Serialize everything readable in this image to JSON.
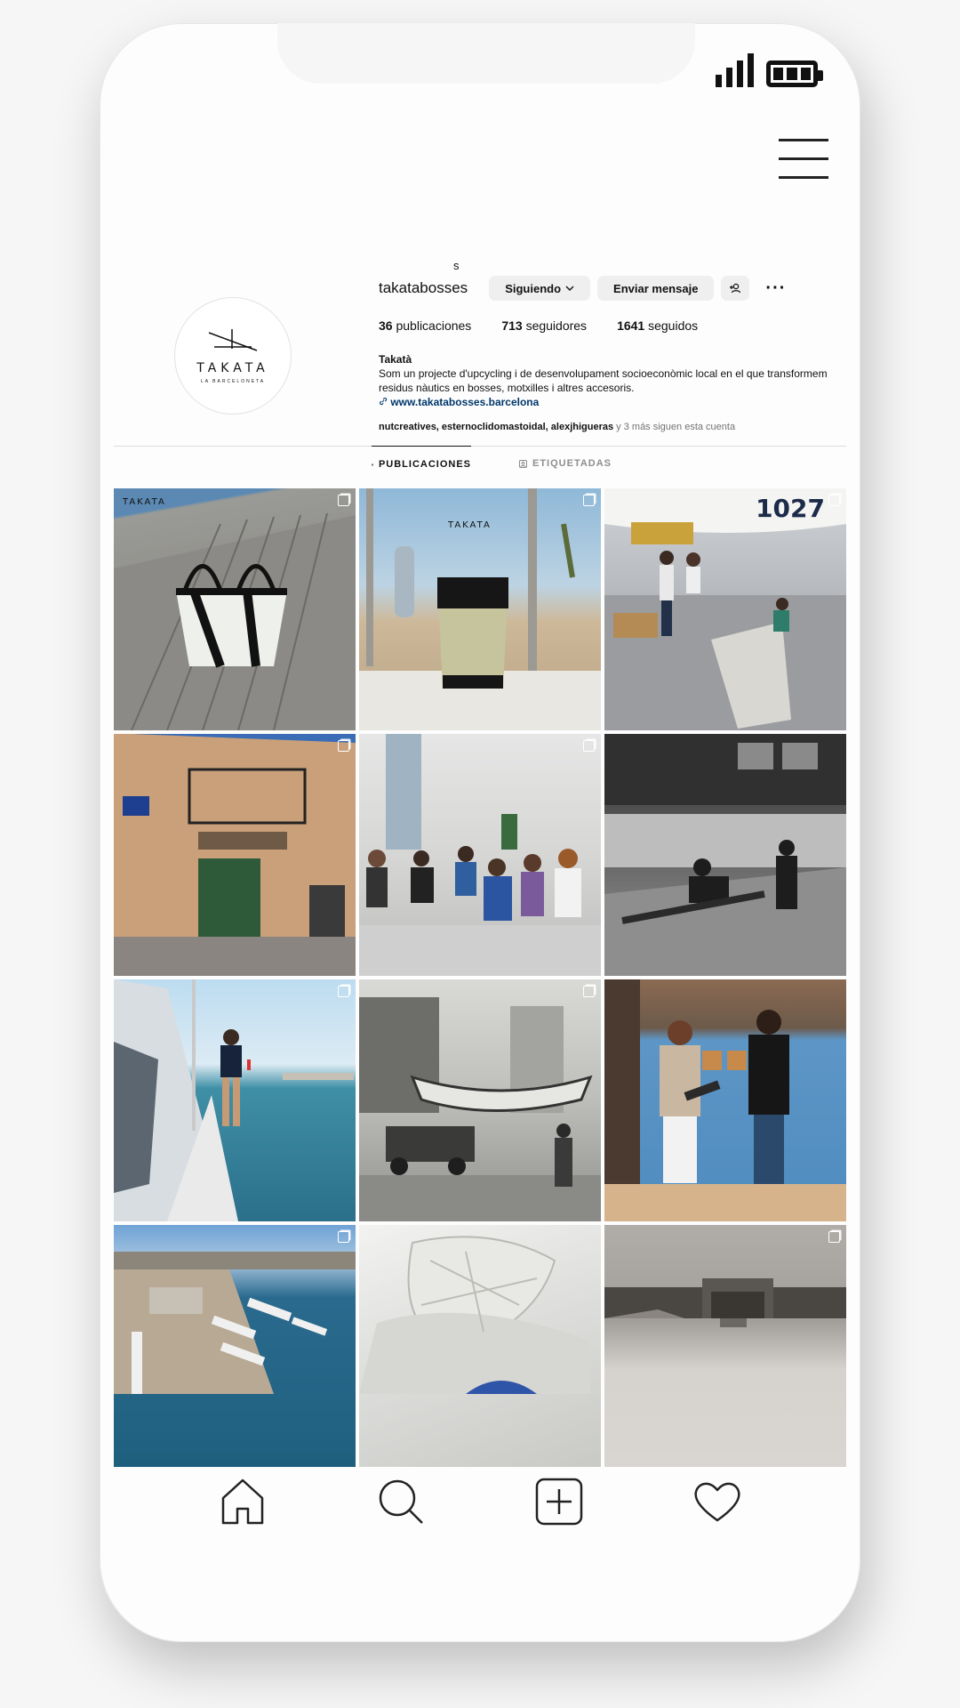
{
  "profile": {
    "verified_mark": "s",
    "username": "takatabosses",
    "buttons": {
      "following": "Siguiendo",
      "message": "Enviar mensaje"
    },
    "more": "···",
    "avatar": {
      "mark": "TAKATA",
      "sub": "LA BARCELONETA"
    },
    "stats": [
      {
        "value": "36",
        "label": "publicaciones"
      },
      {
        "value": "713",
        "label": "seguidores"
      },
      {
        "value": "1641",
        "label": "seguidos"
      }
    ],
    "bio_name": "Takatà",
    "bio_text": "Som un projecte d'upcycling i de desenvolupament socioeconòmic local en el que transformem residus nàutics en bosses, motxilles i altres accesoris.",
    "bio_link": "www.takatabosses.barcelona",
    "followed_by_names": "nutcreatives, esternoclidomastoidal, alexjhigueras",
    "followed_by_more": "y 3 más siguen esta cuenta"
  },
  "tabs": [
    {
      "label": "PUBLICACIONES",
      "icon": "grid-icon",
      "active": true
    },
    {
      "label": "ETIQUETADAS",
      "icon": "tag-icon",
      "active": false
    }
  ],
  "grid": {
    "photos": [
      {
        "subject": "tote-bag-on-pier",
        "overlay": "TAKATA",
        "multi": true
      },
      {
        "subject": "backpack-on-beach",
        "overlay": "TAKATA",
        "multi": true
      },
      {
        "subject": "sail-rolling-workshop",
        "overlay": "1027",
        "multi": true
      },
      {
        "subject": "shop-building-facade",
        "overlay": "",
        "multi": true
      },
      {
        "subject": "group-in-classroom",
        "overlay": "",
        "multi": true
      },
      {
        "subject": "historic-workers-bw",
        "overlay": "",
        "multi": false
      },
      {
        "subject": "woman-on-boat-deck",
        "overlay": "",
        "multi": true
      },
      {
        "subject": "historic-boat-street-bw",
        "overlay": "",
        "multi": true
      },
      {
        "subject": "speakers-at-exhibition",
        "overlay": "",
        "multi": false
      },
      {
        "subject": "aerial-port-view",
        "overlay": "",
        "multi": true
      },
      {
        "subject": "crumpled-sail-fabric",
        "overlay": "",
        "multi": false
      },
      {
        "subject": "old-warehouse-sepia",
        "overlay": "",
        "multi": true
      }
    ]
  },
  "nav": [
    {
      "icon": "home-icon"
    },
    {
      "icon": "search-icon"
    },
    {
      "icon": "add-post-icon"
    },
    {
      "icon": "heart-icon"
    }
  ],
  "colors": {
    "link": "#00376b",
    "muted": "#737373",
    "button_bg": "#efefef"
  }
}
